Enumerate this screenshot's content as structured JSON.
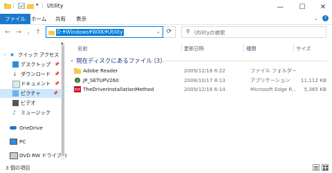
{
  "window": {
    "title": "Utility"
  },
  "ribbon": {
    "tabs": [
      "ファイル",
      "ホーム",
      "共有",
      "表示"
    ]
  },
  "address": {
    "path": "D:¥Windows¥WXK¥Utility"
  },
  "search": {
    "placeholder": "Utilityの検索"
  },
  "nav": {
    "items": [
      {
        "label": "クイック アクセス",
        "icon": "star-icon"
      },
      {
        "label": "デスクトップ",
        "icon": "desktop-icon",
        "pinned": true
      },
      {
        "label": "ダウンロード",
        "icon": "download-icon",
        "pinned": true
      },
      {
        "label": "ドキュメント",
        "icon": "document-icon",
        "pinned": true
      },
      {
        "label": "ピクチャ",
        "icon": "picture-icon",
        "pinned": true
      },
      {
        "label": "ビデオ",
        "icon": "video-icon"
      },
      {
        "label": "ミュージック",
        "icon": "music-icon"
      },
      {
        "label": "OneDrive",
        "icon": "cloud-icon"
      },
      {
        "label": "PC",
        "icon": "pc-icon"
      },
      {
        "label": "DVD RW ドライブ (D",
        "icon": "dvd-icon"
      }
    ]
  },
  "columns": {
    "name": "名前",
    "date": "更新日時",
    "type": "種類",
    "size": "サイズ"
  },
  "group": {
    "label": "現在ディスクにあるファイル (3)"
  },
  "files": [
    {
      "name": "Adobe Reader",
      "date": "2009/12/16 6:22",
      "type": "ファイル フォルダー",
      "size": "",
      "icon": "folder-icon"
    },
    {
      "name": "JP_SETUPV260",
      "date": "2008/10/17 8:13",
      "type": "アプリケーション",
      "size": "11,112 KB",
      "icon": "app-icon"
    },
    {
      "name": "TheDriverInstallationMethod",
      "date": "2009/12/16 6:14",
      "type": "Microsoft Edge R...",
      "size": "5,365 KB",
      "icon": "pdf-icon"
    }
  ],
  "status": {
    "count": "3 個の項目"
  },
  "colors": {
    "accent": "#0078d7",
    "file_tab": "#1979ca",
    "folder": "#f8c948",
    "group_header": "#1e3287"
  }
}
